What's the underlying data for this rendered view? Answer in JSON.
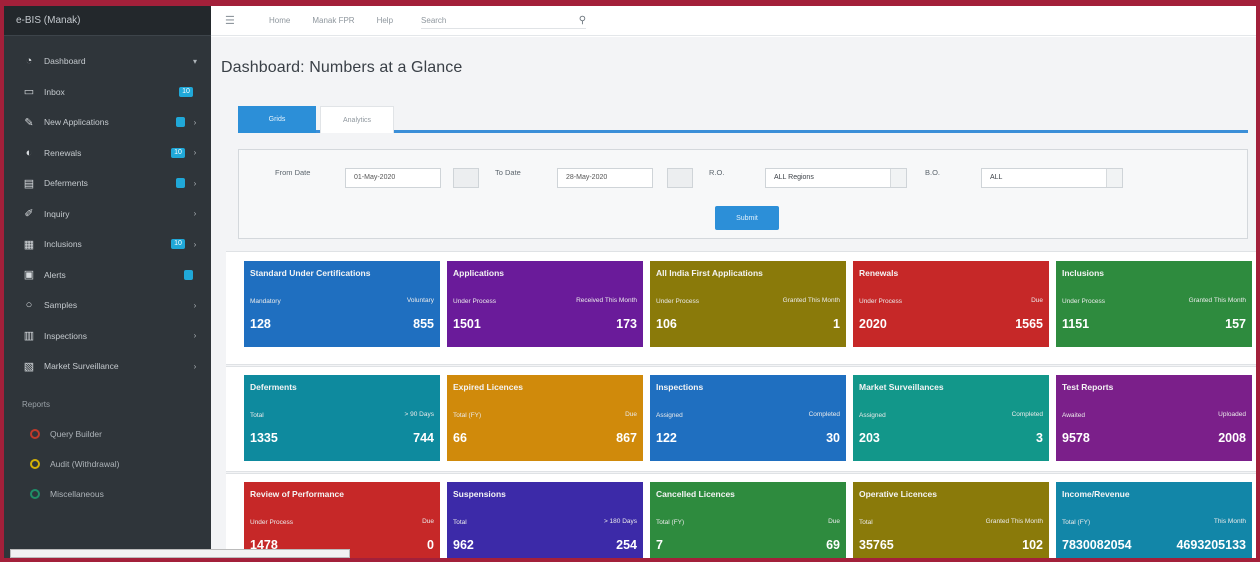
{
  "app": {
    "brand": "e-BIS (Manak)"
  },
  "sidebar": {
    "items": [
      {
        "label": "Dashboard",
        "icon": "dashboard-icon",
        "badge": "",
        "chevron": "▾"
      },
      {
        "label": "Inbox",
        "icon": "inbox-icon",
        "badge": "10",
        "chevron": ""
      },
      {
        "label": "New Applications",
        "icon": "new-applications-icon",
        "badge": " ",
        "chevron": "›"
      },
      {
        "label": "Renewals",
        "icon": "renewals-icon",
        "badge": "10",
        "chevron": "›"
      },
      {
        "label": "Deferments",
        "icon": "deferments-icon",
        "badge": " ",
        "chevron": "›"
      },
      {
        "label": "Inquiry",
        "icon": "inquiry-icon",
        "badge": "",
        "chevron": "›"
      },
      {
        "label": "Inclusions",
        "icon": "inclusions-icon",
        "badge": "10",
        "chevron": "›"
      },
      {
        "label": "Alerts",
        "icon": "alerts-icon",
        "badge": " ",
        "chevron": ""
      },
      {
        "label": "Samples",
        "icon": "samples-icon",
        "badge": "",
        "chevron": "›"
      },
      {
        "label": "Inspections",
        "icon": "inspections-icon",
        "badge": "",
        "chevron": "›"
      },
      {
        "label": "Market Surveillance",
        "icon": "market-surveillance-icon",
        "badge": "",
        "chevron": "›"
      }
    ],
    "reports_title": "Reports",
    "reports": [
      {
        "label": "Query Builder",
        "color": "#c0392b"
      },
      {
        "label": "Audit (Withdrawal)",
        "color": "#d4b106"
      },
      {
        "label": "Miscellaneous",
        "color": "#1e8f6a"
      }
    ]
  },
  "topbar": {
    "links": [
      "Home",
      "Manak FPR",
      "Help"
    ],
    "search_placeholder": "Search"
  },
  "page": {
    "title": "Dashboard: Numbers at a Glance"
  },
  "tabs": [
    "Grids",
    "Analytics"
  ],
  "filter": {
    "from_label": "From Date",
    "from_value": "01-May-2020",
    "to_label": "To Date",
    "to_value": "28-May-2020",
    "ro_label": "R.O.",
    "ro_value": "ALL Regions",
    "bo_label": "B.O.",
    "bo_value": "ALL",
    "submit_label": "Submit"
  },
  "rows": [
    [
      {
        "title": "Standard Under Certifications",
        "left_label": "Mandatory",
        "right_label": "Voluntary",
        "left_value": "128",
        "right_value": "855",
        "color": "#1f6fc0"
      },
      {
        "title": "Applications",
        "left_label": "Under Process",
        "right_label": "Received This Month",
        "left_value": "1501",
        "right_value": "173",
        "color": "#6a1b9a"
      },
      {
        "title": "All India First Applications",
        "left_label": "Under Process",
        "right_label": "Granted This Month",
        "left_value": "106",
        "right_value": "1",
        "color": "#8a7a0a"
      },
      {
        "title": "Renewals",
        "left_label": "Under Process",
        "right_label": "Due",
        "left_value": "2020",
        "right_value": "1565",
        "color": "#c62828"
      },
      {
        "title": "Inclusions",
        "left_label": "Under Process",
        "right_label": "Granted This Month",
        "left_value": "1151",
        "right_value": "157",
        "color": "#2e8b3e"
      }
    ],
    [
      {
        "title": "Deferments",
        "left_label": "Total",
        "right_label": "> 90 Days",
        "left_value": "1335",
        "right_value": "744",
        "color": "#0e8a9e"
      },
      {
        "title": "Expired Licences",
        "left_label": "Total (FY)",
        "right_label": "Due",
        "left_value": "66",
        "right_value": "867",
        "color": "#d08a0b"
      },
      {
        "title": "Inspections",
        "left_label": "Assigned",
        "right_label": "Completed",
        "left_value": "122",
        "right_value": "30",
        "color": "#1f6fc0"
      },
      {
        "title": "Market Surveillances",
        "left_label": "Assigned",
        "right_label": "Completed",
        "left_value": "203",
        "right_value": "3",
        "color": "#12978a"
      },
      {
        "title": "Test Reports",
        "left_label": "Awaited",
        "right_label": "Uploaded",
        "left_value": "9578",
        "right_value": "2008",
        "color": "#7b1f8a"
      }
    ],
    [
      {
        "title": "Review of Performance",
        "left_label": "Under Process",
        "right_label": "Due",
        "left_value": "1478",
        "right_value": "0",
        "color": "#c62828"
      },
      {
        "title": "Suspensions",
        "left_label": "Total",
        "right_label": "> 180 Days",
        "left_value": "962",
        "right_value": "254",
        "color": "#3c2aa8"
      },
      {
        "title": "Cancelled Licences",
        "left_label": "Total (FY)",
        "right_label": "Due",
        "left_value": "7",
        "right_value": "69",
        "color": "#2e8b3e"
      },
      {
        "title": "Operative Licences",
        "left_label": "Total",
        "right_label": "Granted This Month",
        "left_value": "35765",
        "right_value": "102",
        "color": "#8a7a0a"
      },
      {
        "title": "Income/Revenue",
        "left_label": "Total (FY)",
        "right_label": "This Month",
        "left_value": "7830082054",
        "right_value": "4693205133",
        "color": "#1286a8"
      }
    ]
  ]
}
